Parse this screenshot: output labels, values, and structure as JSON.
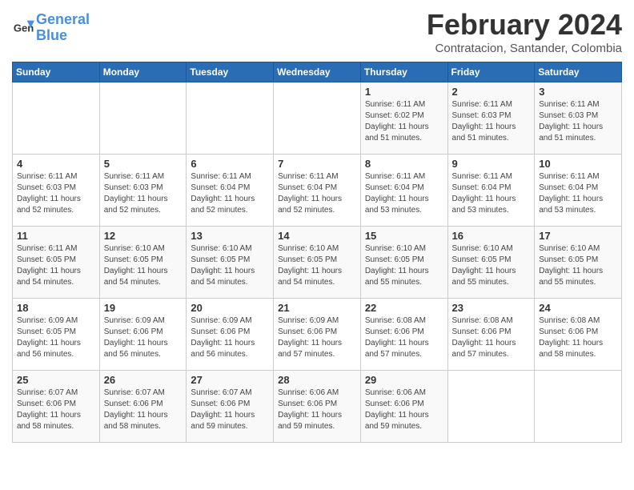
{
  "header": {
    "logo_line1": "General",
    "logo_line2": "Blue",
    "month_year": "February 2024",
    "location": "Contratacion, Santander, Colombia"
  },
  "weekdays": [
    "Sunday",
    "Monday",
    "Tuesday",
    "Wednesday",
    "Thursday",
    "Friday",
    "Saturday"
  ],
  "weeks": [
    [
      {
        "day": "",
        "info": ""
      },
      {
        "day": "",
        "info": ""
      },
      {
        "day": "",
        "info": ""
      },
      {
        "day": "",
        "info": ""
      },
      {
        "day": "1",
        "info": "Sunrise: 6:11 AM\nSunset: 6:02 PM\nDaylight: 11 hours\nand 51 minutes."
      },
      {
        "day": "2",
        "info": "Sunrise: 6:11 AM\nSunset: 6:03 PM\nDaylight: 11 hours\nand 51 minutes."
      },
      {
        "day": "3",
        "info": "Sunrise: 6:11 AM\nSunset: 6:03 PM\nDaylight: 11 hours\nand 51 minutes."
      }
    ],
    [
      {
        "day": "4",
        "info": "Sunrise: 6:11 AM\nSunset: 6:03 PM\nDaylight: 11 hours\nand 52 minutes."
      },
      {
        "day": "5",
        "info": "Sunrise: 6:11 AM\nSunset: 6:03 PM\nDaylight: 11 hours\nand 52 minutes."
      },
      {
        "day": "6",
        "info": "Sunrise: 6:11 AM\nSunset: 6:04 PM\nDaylight: 11 hours\nand 52 minutes."
      },
      {
        "day": "7",
        "info": "Sunrise: 6:11 AM\nSunset: 6:04 PM\nDaylight: 11 hours\nand 52 minutes."
      },
      {
        "day": "8",
        "info": "Sunrise: 6:11 AM\nSunset: 6:04 PM\nDaylight: 11 hours\nand 53 minutes."
      },
      {
        "day": "9",
        "info": "Sunrise: 6:11 AM\nSunset: 6:04 PM\nDaylight: 11 hours\nand 53 minutes."
      },
      {
        "day": "10",
        "info": "Sunrise: 6:11 AM\nSunset: 6:04 PM\nDaylight: 11 hours\nand 53 minutes."
      }
    ],
    [
      {
        "day": "11",
        "info": "Sunrise: 6:11 AM\nSunset: 6:05 PM\nDaylight: 11 hours\nand 54 minutes."
      },
      {
        "day": "12",
        "info": "Sunrise: 6:10 AM\nSunset: 6:05 PM\nDaylight: 11 hours\nand 54 minutes."
      },
      {
        "day": "13",
        "info": "Sunrise: 6:10 AM\nSunset: 6:05 PM\nDaylight: 11 hours\nand 54 minutes."
      },
      {
        "day": "14",
        "info": "Sunrise: 6:10 AM\nSunset: 6:05 PM\nDaylight: 11 hours\nand 54 minutes."
      },
      {
        "day": "15",
        "info": "Sunrise: 6:10 AM\nSunset: 6:05 PM\nDaylight: 11 hours\nand 55 minutes."
      },
      {
        "day": "16",
        "info": "Sunrise: 6:10 AM\nSunset: 6:05 PM\nDaylight: 11 hours\nand 55 minutes."
      },
      {
        "day": "17",
        "info": "Sunrise: 6:10 AM\nSunset: 6:05 PM\nDaylight: 11 hours\nand 55 minutes."
      }
    ],
    [
      {
        "day": "18",
        "info": "Sunrise: 6:09 AM\nSunset: 6:05 PM\nDaylight: 11 hours\nand 56 minutes."
      },
      {
        "day": "19",
        "info": "Sunrise: 6:09 AM\nSunset: 6:06 PM\nDaylight: 11 hours\nand 56 minutes."
      },
      {
        "day": "20",
        "info": "Sunrise: 6:09 AM\nSunset: 6:06 PM\nDaylight: 11 hours\nand 56 minutes."
      },
      {
        "day": "21",
        "info": "Sunrise: 6:09 AM\nSunset: 6:06 PM\nDaylight: 11 hours\nand 57 minutes."
      },
      {
        "day": "22",
        "info": "Sunrise: 6:08 AM\nSunset: 6:06 PM\nDaylight: 11 hours\nand 57 minutes."
      },
      {
        "day": "23",
        "info": "Sunrise: 6:08 AM\nSunset: 6:06 PM\nDaylight: 11 hours\nand 57 minutes."
      },
      {
        "day": "24",
        "info": "Sunrise: 6:08 AM\nSunset: 6:06 PM\nDaylight: 11 hours\nand 58 minutes."
      }
    ],
    [
      {
        "day": "25",
        "info": "Sunrise: 6:07 AM\nSunset: 6:06 PM\nDaylight: 11 hours\nand 58 minutes."
      },
      {
        "day": "26",
        "info": "Sunrise: 6:07 AM\nSunset: 6:06 PM\nDaylight: 11 hours\nand 58 minutes."
      },
      {
        "day": "27",
        "info": "Sunrise: 6:07 AM\nSunset: 6:06 PM\nDaylight: 11 hours\nand 59 minutes."
      },
      {
        "day": "28",
        "info": "Sunrise: 6:06 AM\nSunset: 6:06 PM\nDaylight: 11 hours\nand 59 minutes."
      },
      {
        "day": "29",
        "info": "Sunrise: 6:06 AM\nSunset: 6:06 PM\nDaylight: 11 hours\nand 59 minutes."
      },
      {
        "day": "",
        "info": ""
      },
      {
        "day": "",
        "info": ""
      }
    ]
  ]
}
